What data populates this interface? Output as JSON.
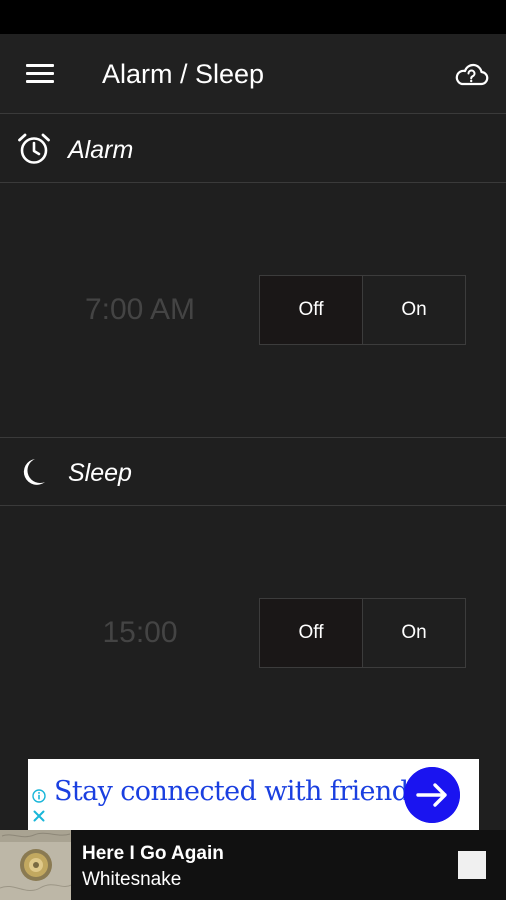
{
  "appbar": {
    "title": "Alarm / Sleep",
    "menu_icon": "hamburger-menu-icon",
    "cloud_icon": "cloud-question-icon"
  },
  "alarm": {
    "label": "Alarm",
    "icon": "alarm-clock-icon",
    "time": "7:00 AM",
    "toggle_off": "Off",
    "toggle_on": "On",
    "selected": "Off"
  },
  "sleep": {
    "label": "Sleep",
    "icon": "moon-icon",
    "time": "15:00",
    "toggle_off": "Off",
    "toggle_on": "On",
    "selected": "Off"
  },
  "ad": {
    "text": "Stay connected with friends",
    "info_icon": "info-icon",
    "close_icon": "close-icon",
    "cta_icon": "arrow-right-icon",
    "accent_color": "#1a14f0"
  },
  "player": {
    "title": "Here I Go Again",
    "artist": "Whitesnake",
    "stop_icon": "stop-icon"
  },
  "colors": {
    "background": "#1f1f1f",
    "divider": "#3a3a3a",
    "muted_time": "#444444",
    "ad_text": "#1a3fe0"
  }
}
